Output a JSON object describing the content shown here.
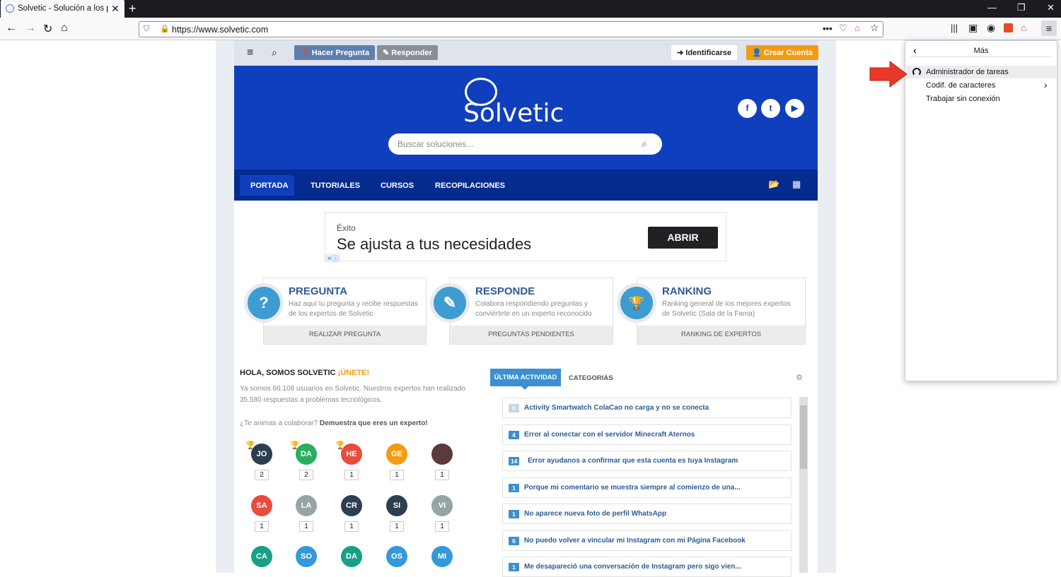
{
  "browser": {
    "tab_title": "Solvetic - Solución a los proble",
    "tab_close": "✕",
    "new_tab": "+",
    "url": "https://www.solvetic.com",
    "window_controls": [
      "—",
      "❐",
      "✕"
    ]
  },
  "site": {
    "topbar": {
      "ask_label": "Hacer Pregunta",
      "answer_label": "Responder",
      "login_label": "Identificarse",
      "register_label": "Crear Cuenta"
    },
    "logo_text": "Solvetic",
    "search_placeholder": "Buscar soluciones...",
    "social": [
      "f",
      "t",
      "▶"
    ],
    "menu": [
      "PORTADA",
      "TUTORIALES",
      "CURSOS",
      "RECOPILACIONES"
    ],
    "ad": {
      "small": "Éxito",
      "big": "Se ajusta a tus necesidades",
      "button": "ABRIR"
    },
    "cards": [
      {
        "title": "PREGUNTA",
        "desc": "Haz aquí tu pregunta y recibe respuestas de los expertos de Solvetic",
        "footer": "REALIZAR PREGUNTA",
        "icon": "?"
      },
      {
        "title": "RESPONDE",
        "desc": "Colabora respondiendo preguntas y conviértete en un experto reconocido",
        "footer": "PREGUNTAS PENDIENTES",
        "icon": "✎"
      },
      {
        "title": "RANKING",
        "desc": "Ranking general de los mejores expertos de Solvetic (Sala de la Fama)",
        "footer": "RANKING DE EXPERTOS",
        "icon": "🏆"
      }
    ],
    "hola": {
      "title": "HOLA, SOMOS SOLVETIC",
      "join": "¡ÚNETE!",
      "text": "Ya somos 66.108 usuarios en Solvetic. Nuestros expertos han realizado 35.580 respuestas a problemas tecnológicos.",
      "q1": "¿Te animas a colaborar?",
      "q2": "Demuestra que eres un experto!"
    },
    "users": [
      {
        "i": "JO",
        "c": "#2c3e50",
        "n": "2"
      },
      {
        "i": "DA",
        "c": "#27ae60",
        "n": "2"
      },
      {
        "i": "HE",
        "c": "#e74c3c",
        "n": "1"
      },
      {
        "i": "GE",
        "c": "#f39c12",
        "n": "1"
      },
      {
        "i": "",
        "c": "#5a3a3a",
        "n": "1"
      },
      {
        "i": "SA",
        "c": "#e74c3c",
        "n": "1"
      },
      {
        "i": "LA",
        "c": "#95a5a6",
        "n": "1"
      },
      {
        "i": "CR",
        "c": "#2c3e50",
        "n": "1"
      },
      {
        "i": "SI",
        "c": "#2c3e50",
        "n": "1"
      },
      {
        "i": "VI",
        "c": "#95a5a6",
        "n": "1"
      },
      {
        "i": "CA",
        "c": "#16a085",
        "n": ""
      },
      {
        "i": "SO",
        "c": "#3498db",
        "n": ""
      },
      {
        "i": "DA",
        "c": "#16a085",
        "n": ""
      },
      {
        "i": "OS",
        "c": "#3498db",
        "n": ""
      },
      {
        "i": "MI",
        "c": "#3498db",
        "n": ""
      }
    ],
    "activity_tabs": [
      "ÚLTIMA ACTIVIDAD",
      "CATEGORIAS"
    ],
    "activity": [
      {
        "n": "0",
        "t": "Activity Smartwatch ColaCao no carga y no se conecta"
      },
      {
        "n": "4",
        "t": "Error al conectar con el servidor Minecraft Aternos"
      },
      {
        "n": "14",
        "t": "Error ayudanos a confirmar que esta cuenta es tuya Instagram"
      },
      {
        "n": "1",
        "t": "Porque mi comentario se muestra siempre al comienzo de una..."
      },
      {
        "n": "1",
        "t": "No aparece nueva foto de perfil WhatsApp"
      },
      {
        "n": "6",
        "t": "No puedo volver a vincular mi Instagram con mi Página Facebook"
      },
      {
        "n": "1",
        "t": "Me desapareció una conversación de Instagram pero sigo vien..."
      }
    ]
  },
  "panel": {
    "title": "Más",
    "items": [
      "Administrador de tareas",
      "Codif. de caracteres",
      "Trabajar sin conexión"
    ]
  }
}
